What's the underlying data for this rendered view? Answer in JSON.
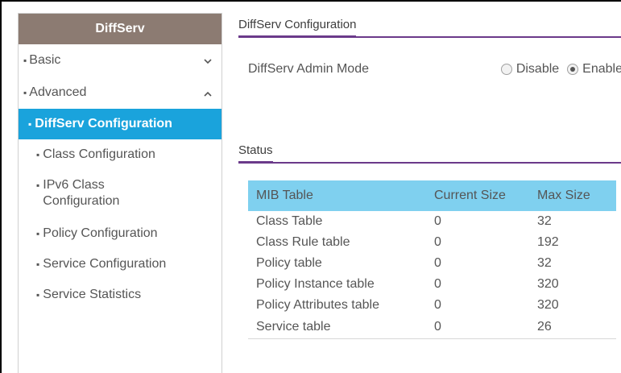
{
  "sidebar": {
    "header": "DiffServ",
    "groups": [
      {
        "label": "Basic",
        "chevron": "chevron-down-icon"
      },
      {
        "label": "Advanced",
        "chevron": "chevron-up-icon"
      }
    ],
    "items": [
      {
        "label": "DiffServ Configuration",
        "active": true
      },
      {
        "label": "Class Configuration"
      },
      {
        "label": "IPv6 Class Configuration"
      },
      {
        "label": "Policy Configuration"
      },
      {
        "label": "Service Configuration"
      },
      {
        "label": "Service Statistics"
      }
    ]
  },
  "main": {
    "section_title": "DiffServ Configuration",
    "admin_mode": {
      "label": "DiffServ Admin Mode",
      "options": [
        "Disable",
        "Enable"
      ],
      "selected": "Enable"
    },
    "status": {
      "title": "Status",
      "columns": [
        "MIB Table",
        "Current Size",
        "Max Size"
      ],
      "rows": [
        [
          "Class Table",
          "0",
          "32"
        ],
        [
          "Class Rule table",
          "0",
          "192"
        ],
        [
          "Policy table",
          "0",
          "32"
        ],
        [
          "Policy Instance table",
          "0",
          "320"
        ],
        [
          "Policy Attributes table",
          "0",
          "320"
        ],
        [
          "Service table",
          "0",
          "26"
        ]
      ]
    }
  },
  "colors": {
    "sidebar_header": "#8c7b72",
    "active_item": "#1aa3dc",
    "accent_line": "#6b3a8a",
    "table_header": "#7fd0ef"
  }
}
